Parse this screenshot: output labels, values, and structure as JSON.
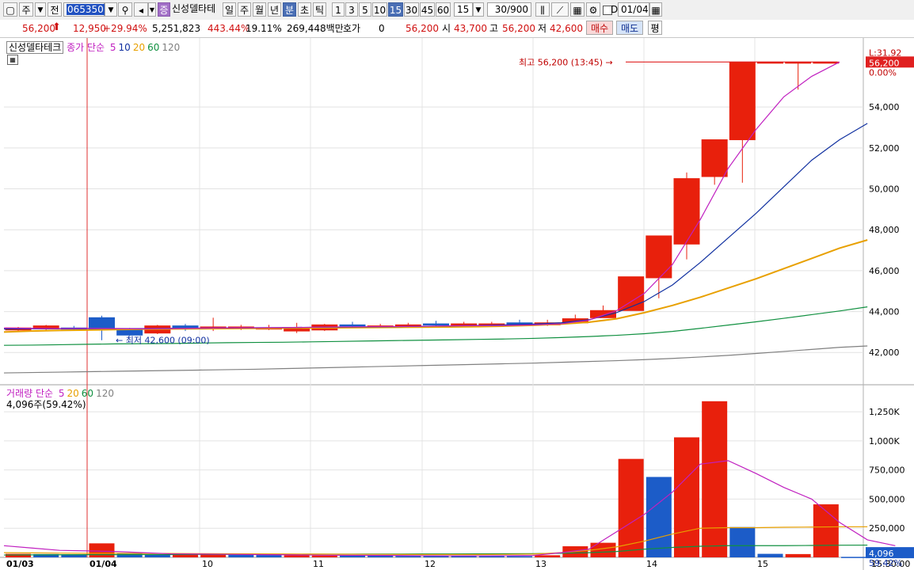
{
  "toolbar": {
    "mode_box": "주",
    "prev_btn": "전",
    "code_value": "065350",
    "stock_badge": "증",
    "stock_name": "신성델타테",
    "periods": [
      "일",
      "주",
      "월",
      "년",
      "분",
      "초",
      "틱"
    ],
    "selected_period": "분",
    "intervals": [
      "1",
      "3",
      "5",
      "10",
      "15",
      "30",
      "45",
      "60"
    ],
    "selected_interval": "15",
    "interval_dropdown": "15",
    "count_text": "30/900",
    "d_checkbox_label": "D",
    "date_value": "01/04"
  },
  "quote": {
    "price": "56,200",
    "change": "12,950",
    "change_pct": "+29.94%",
    "volume": "5,251,823",
    "vol_ratio": "443.44%",
    "turnover": "19.11%",
    "amount": "269,448백만",
    "hoga_label": "호가",
    "hoga_value": "0",
    "current": "56,200",
    "open_label": "시",
    "open": "43,700",
    "high_label": "고",
    "high": "56,200",
    "low_label": "저",
    "low": "42,600",
    "buy_btn": "매수",
    "sell_btn": "매도",
    "eval_btn": "평"
  },
  "price_panel": {
    "stock_label": "신성델타테크",
    "ma_prefix": "종가 단순",
    "ma_labels": [
      {
        "text": "5",
        "color": "#c020c0"
      },
      {
        "text": "10",
        "color": "#1030a0"
      },
      {
        "text": "20",
        "color": "#e8a000"
      },
      {
        "text": "60",
        "color": "#109040"
      },
      {
        "text": "120",
        "color": "#808080"
      }
    ],
    "high_annotation": "최고 56,200 (13:45)",
    "low_annotation": "최저 42,600 (09:00)",
    "right_top_label": "L:31.92",
    "right_price_label": "56,200",
    "right_pct_label": "0.00%",
    "y_ticks": [
      "54,000",
      "52,000",
      "50,000",
      "48,000",
      "46,000",
      "44,000",
      "42,000"
    ]
  },
  "volume_panel": {
    "title": "거래량",
    "ma_prefix": "단순",
    "ma_labels": [
      {
        "text": "5",
        "color": "#c020c0"
      },
      {
        "text": "20",
        "color": "#e8a000"
      },
      {
        "text": "60",
        "color": "#109040"
      },
      {
        "text": "120",
        "color": "#808080"
      }
    ],
    "current_text": "4,096주(59.42%)",
    "right_value": "4,096",
    "right_pct": "59.42%",
    "y_ticks": [
      "1,250K",
      "1,000K",
      "750,000",
      "500,000",
      "250,000"
    ]
  },
  "x_axis": {
    "labels": [
      "01/03",
      "01/04",
      "10",
      "11",
      "12",
      "13",
      "14",
      "15"
    ],
    "right_time": "15:30:00"
  },
  "colors": {
    "up": "#e8200c",
    "down": "#1c5cc8",
    "ma5": "#c020c0",
    "ma10": "#1030a0",
    "ma20": "#e8a000",
    "ma60": "#109040",
    "ma120": "#808080",
    "label_bg": "#e02020",
    "vol_label_bg": "#1c5cc8"
  },
  "chart_data": {
    "type": "candlestick",
    "price_axis": {
      "min": 40500,
      "max": 56600
    },
    "volume_axis": {
      "min": 0,
      "max": 1400000
    },
    "candles": [
      {
        "o": 43100,
        "h": 43250,
        "l": 43000,
        "c": 43200
      },
      {
        "o": 43150,
        "h": 43350,
        "l": 43100,
        "c": 43300
      },
      {
        "o": 43200,
        "h": 43300,
        "l": 43100,
        "c": 43150
      },
      {
        "o": 43700,
        "h": 43800,
        "l": 42600,
        "c": 43150
      },
      {
        "o": 43100,
        "h": 43200,
        "l": 42800,
        "c": 42850
      },
      {
        "o": 42950,
        "h": 43350,
        "l": 42900,
        "c": 43300
      },
      {
        "o": 43300,
        "h": 43400,
        "l": 43050,
        "c": 43150
      },
      {
        "o": 43200,
        "h": 43700,
        "l": 43050,
        "c": 43250
      },
      {
        "o": 43200,
        "h": 43350,
        "l": 43100,
        "c": 43250
      },
      {
        "o": 43200,
        "h": 43350,
        "l": 43100,
        "c": 43200
      },
      {
        "o": 43050,
        "h": 43450,
        "l": 42950,
        "c": 43200
      },
      {
        "o": 43100,
        "h": 43400,
        "l": 43050,
        "c": 43350
      },
      {
        "o": 43350,
        "h": 43500,
        "l": 43200,
        "c": 43300
      },
      {
        "o": 43300,
        "h": 43400,
        "l": 43200,
        "c": 43300
      },
      {
        "o": 43300,
        "h": 43450,
        "l": 43250,
        "c": 43350
      },
      {
        "o": 43400,
        "h": 43550,
        "l": 43250,
        "c": 43350
      },
      {
        "o": 43400,
        "h": 43500,
        "l": 43300,
        "c": 43400
      },
      {
        "o": 43350,
        "h": 43500,
        "l": 43300,
        "c": 43400
      },
      {
        "o": 43450,
        "h": 43600,
        "l": 43300,
        "c": 43350
      },
      {
        "o": 43350,
        "h": 43600,
        "l": 43300,
        "c": 43450
      },
      {
        "o": 43450,
        "h": 43850,
        "l": 43400,
        "c": 43650
      },
      {
        "o": 43700,
        "h": 44300,
        "l": 43700,
        "c": 44050
      },
      {
        "o": 44050,
        "h": 45700,
        "l": 44050,
        "c": 45700
      },
      {
        "o": 45650,
        "h": 46950,
        "l": 44650,
        "c": 47700
      },
      {
        "o": 47300,
        "h": 50800,
        "l": 46550,
        "c": 50500
      },
      {
        "o": 50600,
        "h": 51700,
        "l": 50200,
        "c": 52400
      },
      {
        "o": 52400,
        "h": 55000,
        "l": 50300,
        "c": 56200
      },
      {
        "o": 56200,
        "h": 56200,
        "l": 56200,
        "c": 56200
      },
      {
        "o": 56200,
        "h": 56200,
        "l": 54850,
        "c": 56200
      },
      {
        "o": 56200,
        "h": 56200,
        "l": 56200,
        "c": 56200
      }
    ],
    "volumes": [
      {
        "v": 30000,
        "up": true
      },
      {
        "v": 28000,
        "up": false
      },
      {
        "v": 26000,
        "up": false
      },
      {
        "v": 120000,
        "up": true
      },
      {
        "v": 30000,
        "up": false
      },
      {
        "v": 25000,
        "up": false
      },
      {
        "v": 32000,
        "up": true
      },
      {
        "v": 28000,
        "up": true
      },
      {
        "v": 22000,
        "up": false
      },
      {
        "v": 20000,
        "up": false
      },
      {
        "v": 18000,
        "up": true
      },
      {
        "v": 16000,
        "up": true
      },
      {
        "v": 15000,
        "up": false
      },
      {
        "v": 14000,
        "up": false
      },
      {
        "v": 12000,
        "up": false
      },
      {
        "v": 14000,
        "up": false
      },
      {
        "v": 12000,
        "up": false
      },
      {
        "v": 10000,
        "up": false
      },
      {
        "v": 10000,
        "up": false
      },
      {
        "v": 18000,
        "up": true
      },
      {
        "v": 95000,
        "up": true
      },
      {
        "v": 125000,
        "up": true
      },
      {
        "v": 845000,
        "up": true
      },
      {
        "v": 690000,
        "up": false
      },
      {
        "v": 1030000,
        "up": true
      },
      {
        "v": 1340000,
        "up": true
      },
      {
        "v": 260000,
        "up": false
      },
      {
        "v": 30000,
        "up": false
      },
      {
        "v": 28000,
        "up": true
      },
      {
        "v": 455000,
        "up": true
      },
      {
        "v": 4096,
        "up": false
      }
    ],
    "ma_price": {
      "ma5": [
        43200,
        43180,
        43170,
        43180,
        43170,
        43160,
        43170,
        43190,
        43200,
        43210,
        43220,
        43230,
        43250,
        43260,
        43270,
        43280,
        43300,
        43310,
        43320,
        43350,
        43400,
        43580,
        44050,
        44900,
        46300,
        48500,
        51000,
        52900,
        54500,
        55500,
        56200
      ],
      "ma10": [
        43150,
        43160,
        43160,
        43170,
        43170,
        43170,
        43180,
        43190,
        43200,
        43210,
        43220,
        43230,
        43240,
        43250,
        43260,
        43280,
        43300,
        43320,
        43350,
        43390,
        43450,
        43600,
        43950,
        44500,
        45300,
        46400,
        47600,
        48800,
        50100,
        51400,
        52400,
        53200
      ],
      "ma20": [
        43000,
        43050,
        43080,
        43100,
        43120,
        43140,
        43150,
        43160,
        43170,
        43180,
        43190,
        43200,
        43210,
        43220,
        43230,
        43240,
        43250,
        43260,
        43290,
        43330,
        43390,
        43480,
        43650,
        43950,
        44300,
        44700,
        45150,
        45600,
        46100,
        46600,
        47100,
        47500
      ],
      "ma60": [
        42350,
        42360,
        42380,
        42400,
        42420,
        42430,
        42440,
        42460,
        42480,
        42490,
        42500,
        42520,
        42540,
        42560,
        42580,
        42600,
        42620,
        42640,
        42660,
        42690,
        42730,
        42780,
        42840,
        42920,
        43030,
        43180,
        43340,
        43500,
        43670,
        43850,
        44030,
        44230
      ],
      "ma120": [
        41000,
        41020,
        41040,
        41060,
        41080,
        41100,
        41120,
        41140,
        41160,
        41180,
        41210,
        41240,
        41270,
        41300,
        41330,
        41360,
        41390,
        41420,
        41450,
        41480,
        41520,
        41560,
        41600,
        41650,
        41710,
        41780,
        41860,
        41950,
        42050,
        42150,
        42250,
        42320
      ]
    },
    "ma_volume": {
      "ma5": [
        100000,
        80000,
        60000,
        55000,
        50000,
        40000,
        30000,
        28000,
        26000,
        24000,
        22000,
        20000,
        18000,
        17000,
        16000,
        14000,
        13000,
        13000,
        14000,
        16000,
        40000,
        70000,
        220000,
        370000,
        560000,
        800000,
        830000,
        720000,
        600000,
        500000,
        300000,
        150000,
        100000
      ],
      "ma20": [
        40000,
        38000,
        36000,
        35000,
        35000,
        34000,
        33000,
        32000,
        31000,
        30000,
        29000,
        28000,
        27000,
        26000,
        25000,
        24000,
        24000,
        24000,
        25000,
        28000,
        40000,
        60000,
        90000,
        140000,
        200000,
        250000,
        255000,
        255000,
        258000,
        260000,
        262000,
        262000
      ],
      "ma60": [
        20000,
        21000,
        22000,
        23000,
        23000,
        24000,
        24000,
        25000,
        25000,
        26000,
        26000,
        27000,
        27000,
        28000,
        28000,
        29000,
        29000,
        30000,
        31000,
        32000,
        35000,
        40000,
        50000,
        70000,
        85000,
        95000,
        100000,
        100000,
        100000,
        102000,
        104000,
        105000
      ]
    },
    "x_tick_labels": [
      "01/03",
      "01/04",
      "10",
      "11",
      "12",
      "13",
      "14",
      "15"
    ]
  }
}
